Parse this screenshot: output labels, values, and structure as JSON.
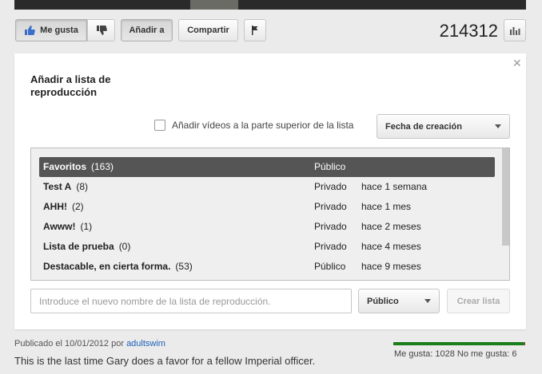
{
  "actions": {
    "like_label": "Me gusta",
    "add_to_label": "Añadir a",
    "share_label": "Compartir"
  },
  "view_count": "214312",
  "playlist_panel": {
    "title": "Añadir a lista de reproducción",
    "add_to_top_label": "Añadir vídeos a la parte superior de la lista",
    "add_to_top_checked": false,
    "sort_selected": "Fecha de creación",
    "playlists": [
      {
        "name": "Favoritos",
        "count": "(163)",
        "privacy": "Público",
        "date": "",
        "selected": true
      },
      {
        "name": "Test A",
        "count": "(8)",
        "privacy": "Privado",
        "date": "hace 1 semana",
        "selected": false
      },
      {
        "name": "AHH!",
        "count": "(2)",
        "privacy": "Privado",
        "date": "hace 1 mes",
        "selected": false
      },
      {
        "name": "Awww!",
        "count": "(1)",
        "privacy": "Privado",
        "date": "hace 2 meses",
        "selected": false
      },
      {
        "name": "Lista de prueba",
        "count": "(0)",
        "privacy": "Privado",
        "date": "hace 4 meses",
        "selected": false
      },
      {
        "name": "Destacable, en cierta forma.",
        "count": "(53)",
        "privacy": "Público",
        "date": "hace 9 meses",
        "selected": false
      }
    ],
    "new_name_placeholder": "Introduce el nuevo nombre de la lista de reproducción.",
    "privacy_selected": "Público",
    "create_label": "Crear lista"
  },
  "published": {
    "prefix": "Publicado el 10/01/2012 por",
    "author": "adultswim"
  },
  "description": "This is the last time Gary does a favor for a fellow Imperial officer.",
  "likes": {
    "summary": "Me gusta: 1028 No me gusta: 6",
    "like_fraction": 0.994
  },
  "colors": {
    "like_bar": "#1a7f1a",
    "dislike_bar": "#cc3333",
    "link": "#1c62b9",
    "selected_row": "#555555"
  },
  "icons": [
    "thumbs-up-icon",
    "thumbs-down-icon",
    "flag-icon",
    "stats-icon",
    "close-icon",
    "chevron-down-icon"
  ]
}
